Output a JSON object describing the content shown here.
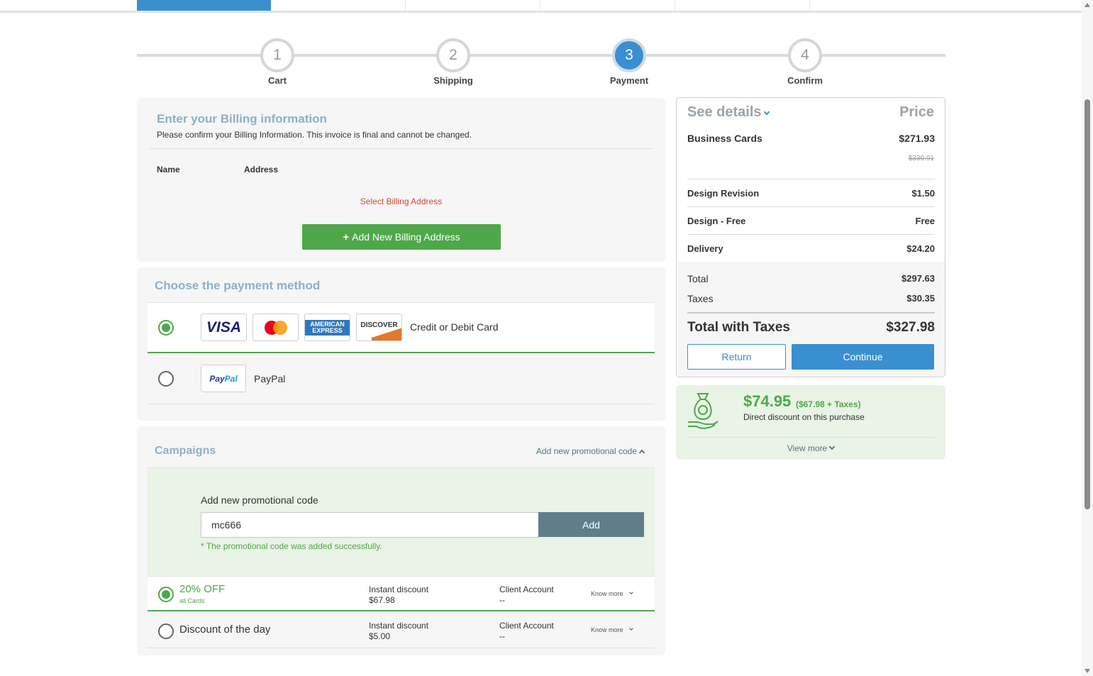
{
  "steps": [
    {
      "num": "1",
      "label": "Cart"
    },
    {
      "num": "2",
      "label": "Shipping"
    },
    {
      "num": "3",
      "label": "Payment"
    },
    {
      "num": "4",
      "label": "Confirm"
    }
  ],
  "billing": {
    "title": "Enter your Billing information",
    "subtitle": "Please confirm your Billing Information. This invoice is final and cannot be changed.",
    "col_name": "Name",
    "col_address": "Address",
    "warning": "Select Billing Address",
    "add_button": "Add New Billing Address"
  },
  "payment": {
    "title": "Choose the payment method",
    "card_label": "Credit or Debit Card",
    "card_logos": {
      "visa": "VISA",
      "amex": "AMERICAN EXPRESS",
      "discover": "DISCOVER"
    },
    "paypal_label": "PayPal",
    "paypal_logo": {
      "pay": "Pay",
      "pal": "Pal"
    },
    "selected": "card"
  },
  "campaigns": {
    "title": "Campaigns",
    "add_link": "Add new promotional code",
    "promo_label": "Add new promotional code",
    "promo_value": "mc666",
    "add_button": "Add",
    "success": "* The promotional code was added successfully.",
    "rows": [
      {
        "name": "20% OFF",
        "sub": "all Cards",
        "discount_label": "Instant discount",
        "discount_value": "$67.98",
        "account_label": "Client Account",
        "account_value": "--",
        "know_more": "Know more",
        "selected": true
      },
      {
        "name": "Discount of the day",
        "sub": "",
        "discount_label": "Instant discount",
        "discount_value": "$5.00",
        "account_label": "Client Account",
        "account_value": "--",
        "know_more": "Know more",
        "selected": false
      }
    ]
  },
  "summary": {
    "see_details": "See details",
    "price_header": "Price",
    "product": "Business Cards",
    "product_price": "$271.93",
    "product_old_price": "$339.91",
    "lines": [
      {
        "label": "Design Revision",
        "value": "$1.50"
      },
      {
        "label": "Design - Free",
        "value": "Free"
      },
      {
        "label": "Delivery",
        "value": "$24.20"
      }
    ],
    "total_label": "Total",
    "total_value": "$297.63",
    "taxes_label": "Taxes",
    "taxes_value": "$30.35",
    "grand_label": "Total with Taxes",
    "grand_value": "$327.98",
    "return_button": "Return",
    "continue_button": "Continue"
  },
  "discount": {
    "amount": "$74.95",
    "amount_detail": "($67.98 + Taxes)",
    "description": "Direct discount on this purchase",
    "view_more": "View more"
  },
  "colors": {
    "accent_blue": "#3a8fd0",
    "green": "#4ea84a",
    "heading_blue": "#8eb0c6",
    "warning_red": "#d0453a"
  }
}
